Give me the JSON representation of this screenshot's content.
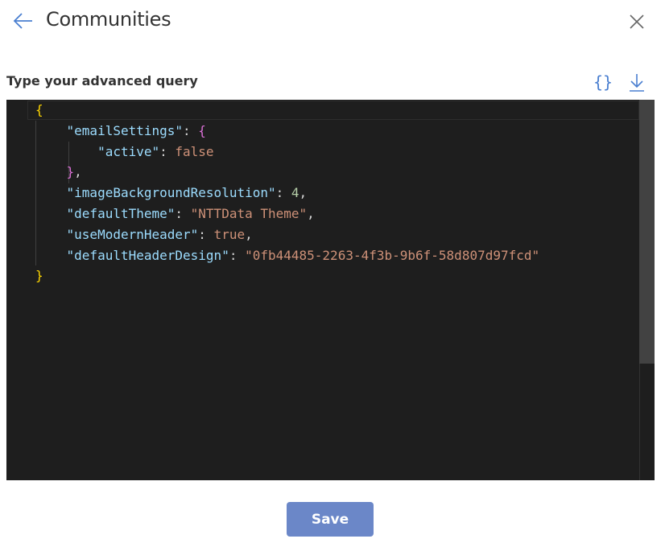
{
  "header": {
    "title": "Communities",
    "back_icon": "arrow-left-icon",
    "close_icon": "close-icon"
  },
  "query": {
    "label": "Type your advanced query",
    "format_label": "{}",
    "format_icon": "braces-icon",
    "download_icon": "download-icon"
  },
  "editor": {
    "lines": [
      {
        "tokens": [
          {
            "t": "{",
            "c": "brace1"
          }
        ]
      },
      {
        "tokens": [
          {
            "t": "    ",
            "c": "punc"
          },
          {
            "t": "\"emailSettings\"",
            "c": "key"
          },
          {
            "t": ": ",
            "c": "punc"
          },
          {
            "t": "{",
            "c": "brace2"
          }
        ]
      },
      {
        "tokens": [
          {
            "t": "        ",
            "c": "punc"
          },
          {
            "t": "\"active\"",
            "c": "key"
          },
          {
            "t": ": ",
            "c": "punc"
          },
          {
            "t": "false",
            "c": "str"
          }
        ]
      },
      {
        "tokens": [
          {
            "t": "    ",
            "c": "punc"
          },
          {
            "t": "}",
            "c": "brace2"
          },
          {
            "t": ",",
            "c": "punc"
          }
        ]
      },
      {
        "tokens": [
          {
            "t": "    ",
            "c": "punc"
          },
          {
            "t": "\"imageBackgroundResolution\"",
            "c": "key"
          },
          {
            "t": ": ",
            "c": "punc"
          },
          {
            "t": "4",
            "c": "num"
          },
          {
            "t": ",",
            "c": "punc"
          }
        ]
      },
      {
        "tokens": [
          {
            "t": "    ",
            "c": "punc"
          },
          {
            "t": "\"defaultTheme\"",
            "c": "key"
          },
          {
            "t": ": ",
            "c": "punc"
          },
          {
            "t": "\"NTTData Theme\"",
            "c": "str"
          },
          {
            "t": ",",
            "c": "punc"
          }
        ]
      },
      {
        "tokens": [
          {
            "t": "    ",
            "c": "punc"
          },
          {
            "t": "\"useModernHeader\"",
            "c": "key"
          },
          {
            "t": ": ",
            "c": "punc"
          },
          {
            "t": "true",
            "c": "str"
          },
          {
            "t": ",",
            "c": "punc"
          }
        ]
      },
      {
        "tokens": [
          {
            "t": "    ",
            "c": "punc"
          },
          {
            "t": "\"defaultHeaderDesign\"",
            "c": "key"
          },
          {
            "t": ": ",
            "c": "punc"
          },
          {
            "t": "\"0fb44485-2263-4f3b-9b6f-58d807d97fcd\"",
            "c": "str"
          }
        ]
      },
      {
        "tokens": [
          {
            "t": "}",
            "c": "brace1"
          }
        ]
      }
    ]
  },
  "footer": {
    "save_label": "Save"
  },
  "colors": {
    "accent": "#4a7fd0",
    "save_button": "#6b87c8",
    "editor_bg": "#1e1e1e"
  }
}
